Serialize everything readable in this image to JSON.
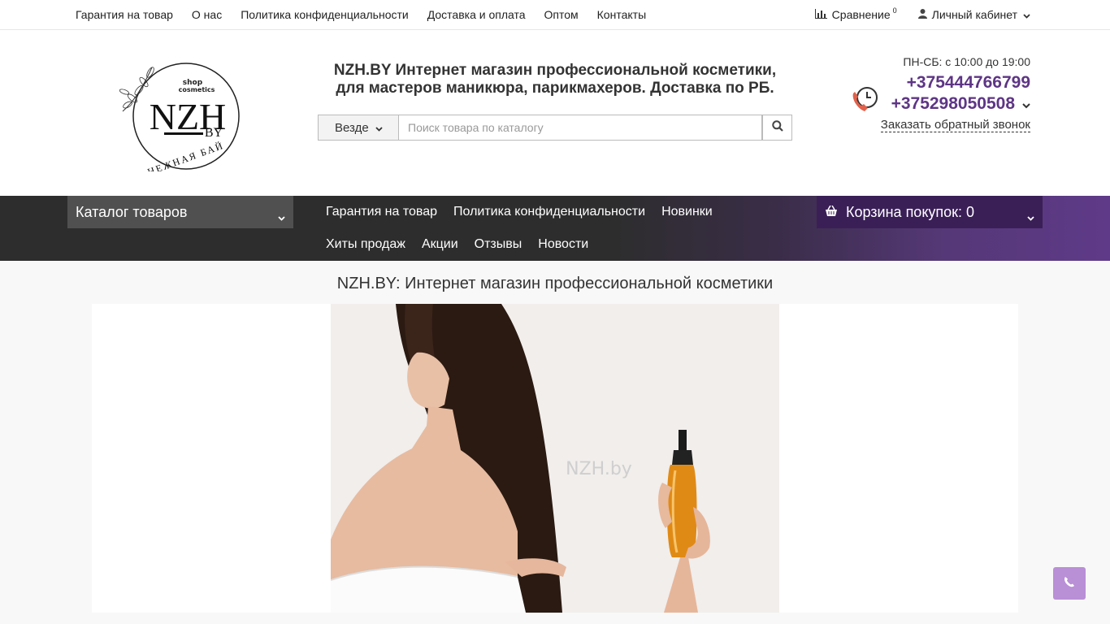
{
  "topbar": {
    "links": [
      "Гарантия на товар",
      "О нас",
      "Политика конфиденциальности",
      "Доставка и оплата",
      "Оптом",
      "Контакты"
    ],
    "compare_label": "Сравнение",
    "compare_count": "0",
    "account_label": "Личный кабинет"
  },
  "header": {
    "logo_text_main": "NZH",
    "logo_text_by": "BY",
    "logo_text_shop": "shop",
    "logo_text_cosmetics": "cosmetics",
    "logo_text_bottom": "НЕЖНАЯ БАЙ",
    "title": "NZH.BY Интернет магазин профессиональной косметики, для мастеров маникюра, парикмахеров. Доставка по РБ.",
    "search_scope": "Везде",
    "search_placeholder": "Поиск товара по каталогу",
    "hours": "ПН-СБ: с 10:00 до 19:00",
    "phone1": "+375444766799",
    "phone2": "+375298050508",
    "callback": "Заказать обратный звонок"
  },
  "mainnav": {
    "catalog_label": "Каталог товаров",
    "row1": [
      "Гарантия на товар",
      "Политика конфиденциальности",
      "Новинки"
    ],
    "row2": [
      "Хиты продаж",
      "Акции",
      "Отзывы",
      "Новости"
    ],
    "cart_label": "Корзина покупок: 0"
  },
  "content": {
    "page_heading": "NZH.BY: Интернет магазин профессиональной косметики",
    "banner_watermark": "NZH.by"
  },
  "colors": {
    "accent": "#5e3585",
    "nav_dark": "#2d2d2d",
    "cart_bg": "#3a1f57",
    "fab": "#b98fd6"
  },
  "icons": {
    "compare": "bar-chart-icon",
    "account": "user-icon",
    "search": "search-icon",
    "phone": "phone-clock-icon",
    "cart": "basket-icon",
    "fab": "phone-icon"
  }
}
